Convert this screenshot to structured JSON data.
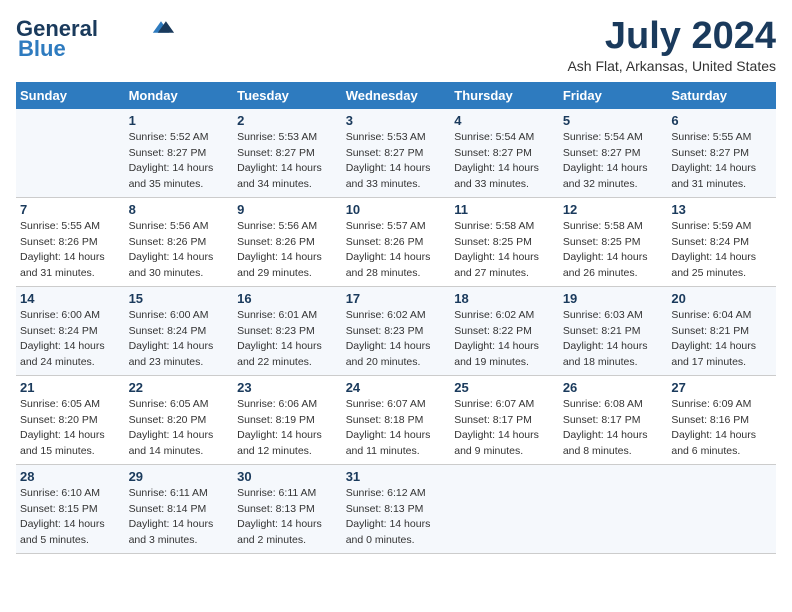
{
  "header": {
    "logo_line1": "General",
    "logo_line2": "Blue",
    "title": "July 2024",
    "subtitle": "Ash Flat, Arkansas, United States"
  },
  "days_of_week": [
    "Sunday",
    "Monday",
    "Tuesday",
    "Wednesday",
    "Thursday",
    "Friday",
    "Saturday"
  ],
  "weeks": [
    [
      {
        "day": "",
        "detail": ""
      },
      {
        "day": "1",
        "detail": "Sunrise: 5:52 AM\nSunset: 8:27 PM\nDaylight: 14 hours\nand 35 minutes."
      },
      {
        "day": "2",
        "detail": "Sunrise: 5:53 AM\nSunset: 8:27 PM\nDaylight: 14 hours\nand 34 minutes."
      },
      {
        "day": "3",
        "detail": "Sunrise: 5:53 AM\nSunset: 8:27 PM\nDaylight: 14 hours\nand 33 minutes."
      },
      {
        "day": "4",
        "detail": "Sunrise: 5:54 AM\nSunset: 8:27 PM\nDaylight: 14 hours\nand 33 minutes."
      },
      {
        "day": "5",
        "detail": "Sunrise: 5:54 AM\nSunset: 8:27 PM\nDaylight: 14 hours\nand 32 minutes."
      },
      {
        "day": "6",
        "detail": "Sunrise: 5:55 AM\nSunset: 8:27 PM\nDaylight: 14 hours\nand 31 minutes."
      }
    ],
    [
      {
        "day": "7",
        "detail": "Sunrise: 5:55 AM\nSunset: 8:26 PM\nDaylight: 14 hours\nand 31 minutes."
      },
      {
        "day": "8",
        "detail": "Sunrise: 5:56 AM\nSunset: 8:26 PM\nDaylight: 14 hours\nand 30 minutes."
      },
      {
        "day": "9",
        "detail": "Sunrise: 5:56 AM\nSunset: 8:26 PM\nDaylight: 14 hours\nand 29 minutes."
      },
      {
        "day": "10",
        "detail": "Sunrise: 5:57 AM\nSunset: 8:26 PM\nDaylight: 14 hours\nand 28 minutes."
      },
      {
        "day": "11",
        "detail": "Sunrise: 5:58 AM\nSunset: 8:25 PM\nDaylight: 14 hours\nand 27 minutes."
      },
      {
        "day": "12",
        "detail": "Sunrise: 5:58 AM\nSunset: 8:25 PM\nDaylight: 14 hours\nand 26 minutes."
      },
      {
        "day": "13",
        "detail": "Sunrise: 5:59 AM\nSunset: 8:24 PM\nDaylight: 14 hours\nand 25 minutes."
      }
    ],
    [
      {
        "day": "14",
        "detail": "Sunrise: 6:00 AM\nSunset: 8:24 PM\nDaylight: 14 hours\nand 24 minutes."
      },
      {
        "day": "15",
        "detail": "Sunrise: 6:00 AM\nSunset: 8:24 PM\nDaylight: 14 hours\nand 23 minutes."
      },
      {
        "day": "16",
        "detail": "Sunrise: 6:01 AM\nSunset: 8:23 PM\nDaylight: 14 hours\nand 22 minutes."
      },
      {
        "day": "17",
        "detail": "Sunrise: 6:02 AM\nSunset: 8:23 PM\nDaylight: 14 hours\nand 20 minutes."
      },
      {
        "day": "18",
        "detail": "Sunrise: 6:02 AM\nSunset: 8:22 PM\nDaylight: 14 hours\nand 19 minutes."
      },
      {
        "day": "19",
        "detail": "Sunrise: 6:03 AM\nSunset: 8:21 PM\nDaylight: 14 hours\nand 18 minutes."
      },
      {
        "day": "20",
        "detail": "Sunrise: 6:04 AM\nSunset: 8:21 PM\nDaylight: 14 hours\nand 17 minutes."
      }
    ],
    [
      {
        "day": "21",
        "detail": "Sunrise: 6:05 AM\nSunset: 8:20 PM\nDaylight: 14 hours\nand 15 minutes."
      },
      {
        "day": "22",
        "detail": "Sunrise: 6:05 AM\nSunset: 8:20 PM\nDaylight: 14 hours\nand 14 minutes."
      },
      {
        "day": "23",
        "detail": "Sunrise: 6:06 AM\nSunset: 8:19 PM\nDaylight: 14 hours\nand 12 minutes."
      },
      {
        "day": "24",
        "detail": "Sunrise: 6:07 AM\nSunset: 8:18 PM\nDaylight: 14 hours\nand 11 minutes."
      },
      {
        "day": "25",
        "detail": "Sunrise: 6:07 AM\nSunset: 8:17 PM\nDaylight: 14 hours\nand 9 minutes."
      },
      {
        "day": "26",
        "detail": "Sunrise: 6:08 AM\nSunset: 8:17 PM\nDaylight: 14 hours\nand 8 minutes."
      },
      {
        "day": "27",
        "detail": "Sunrise: 6:09 AM\nSunset: 8:16 PM\nDaylight: 14 hours\nand 6 minutes."
      }
    ],
    [
      {
        "day": "28",
        "detail": "Sunrise: 6:10 AM\nSunset: 8:15 PM\nDaylight: 14 hours\nand 5 minutes."
      },
      {
        "day": "29",
        "detail": "Sunrise: 6:11 AM\nSunset: 8:14 PM\nDaylight: 14 hours\nand 3 minutes."
      },
      {
        "day": "30",
        "detail": "Sunrise: 6:11 AM\nSunset: 8:13 PM\nDaylight: 14 hours\nand 2 minutes."
      },
      {
        "day": "31",
        "detail": "Sunrise: 6:12 AM\nSunset: 8:13 PM\nDaylight: 14 hours\nand 0 minutes."
      },
      {
        "day": "",
        "detail": ""
      },
      {
        "day": "",
        "detail": ""
      },
      {
        "day": "",
        "detail": ""
      }
    ]
  ]
}
